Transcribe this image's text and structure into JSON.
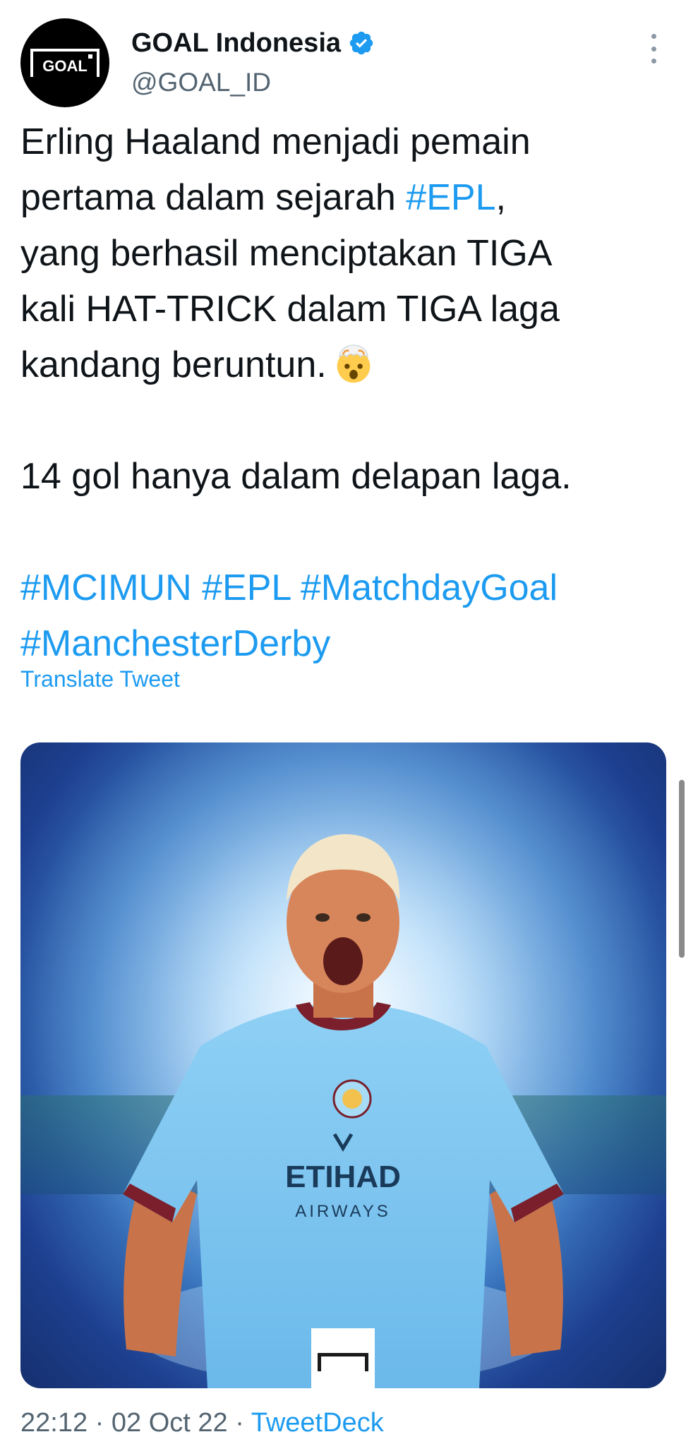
{
  "author": {
    "display_name": "GOAL Indonesia",
    "handle": "@GOAL_ID",
    "avatar_logo_text": "GOAL",
    "verified_color": "#1d9bf0"
  },
  "tweet": {
    "line1": "Erling Haaland menjadi pemain",
    "line2_text": "pertama dalam sejarah ",
    "line2_hashtag": "#EPL",
    "line2_suffix": ",",
    "line3": "yang berhasil menciptakan TIGA",
    "line4": "kali HAT-TRICK dalam TIGA laga",
    "line5": "kandang beruntun.",
    "emoji": "exploding-head-emoji",
    "line6": "14 gol hanya dalam delapan laga.",
    "hashtags_line1": "#MCIMUN #EPL #MatchdayGoal",
    "hashtags_line2": "#ManchesterDerby",
    "translate_label": "Translate Tweet"
  },
  "media": {
    "description_icon": "player-photo",
    "jersey_sponsor": "ETIHAD",
    "jersey_sponsor_sub": "AIRWAYS"
  },
  "meta": {
    "time": "22:12",
    "separator": " · ",
    "date": "02 Oct 22",
    "source": "TweetDeck"
  },
  "colors": {
    "link": "#1d9bf0",
    "text": "#0f1419",
    "secondary": "#536471"
  }
}
